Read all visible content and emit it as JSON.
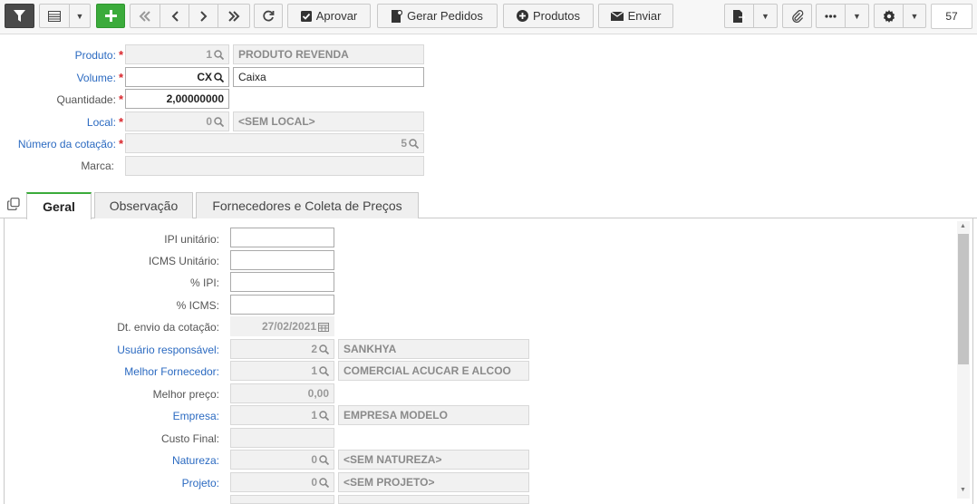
{
  "toolbar": {
    "approve_label": "Aprovar",
    "generate_orders_label": "Gerar Pedidos",
    "products_label": "Produtos",
    "send_label": "Enviar",
    "record_count": "57"
  },
  "form": {
    "produto": {
      "label": "Produto:",
      "code": "1",
      "desc": "PRODUTO REVENDA"
    },
    "volume": {
      "label": "Volume:",
      "code": "CX",
      "desc": "Caixa"
    },
    "quantidade": {
      "label": "Quantidade:",
      "value": "2,00000000"
    },
    "local": {
      "label": "Local:",
      "code": "0",
      "desc": "<SEM LOCAL>"
    },
    "numero_cotacao": {
      "label": "Número da cotação:",
      "value": "5"
    },
    "marca": {
      "label": "Marca:",
      "value": ""
    }
  },
  "tabs": [
    {
      "label": "Geral",
      "active": true
    },
    {
      "label": "Observação",
      "active": false
    },
    {
      "label": "Fornecedores e Coleta de Preços",
      "active": false
    }
  ],
  "geral": {
    "ipi_unitario": {
      "label": "IPI unitário:",
      "value": ""
    },
    "icms_unitario": {
      "label": "ICMS Unitário:",
      "value": ""
    },
    "pct_ipi": {
      "label": "% IPI:",
      "value": ""
    },
    "pct_icms": {
      "label": "% ICMS:",
      "value": ""
    },
    "dt_envio": {
      "label": "Dt. envio da cotação:",
      "value": "27/02/2021"
    },
    "usuario": {
      "label": "Usuário responsável:",
      "code": "2",
      "desc": "SANKHYA"
    },
    "melhor_fornecedor": {
      "label": "Melhor Fornecedor:",
      "code": "1",
      "desc": "COMERCIAL ACUCAR E ALCOO"
    },
    "melhor_preco": {
      "label": "Melhor preço:",
      "value": "0,00"
    },
    "empresa": {
      "label": "Empresa:",
      "code": "1",
      "desc": "EMPRESA MODELO"
    },
    "custo_final": {
      "label": "Custo Final:",
      "value": ""
    },
    "natureza": {
      "label": "Natureza:",
      "code": "0",
      "desc": "<SEM NATUREZA>"
    },
    "projeto": {
      "label": "Projeto:",
      "code": "0",
      "desc": "<SEM PROJETO>"
    }
  },
  "colors": {
    "accent_green": "#3bab3b",
    "link_blue": "#2b6ac1",
    "required_red": "#d9262c",
    "filter_dark": "#4a4a4a"
  }
}
